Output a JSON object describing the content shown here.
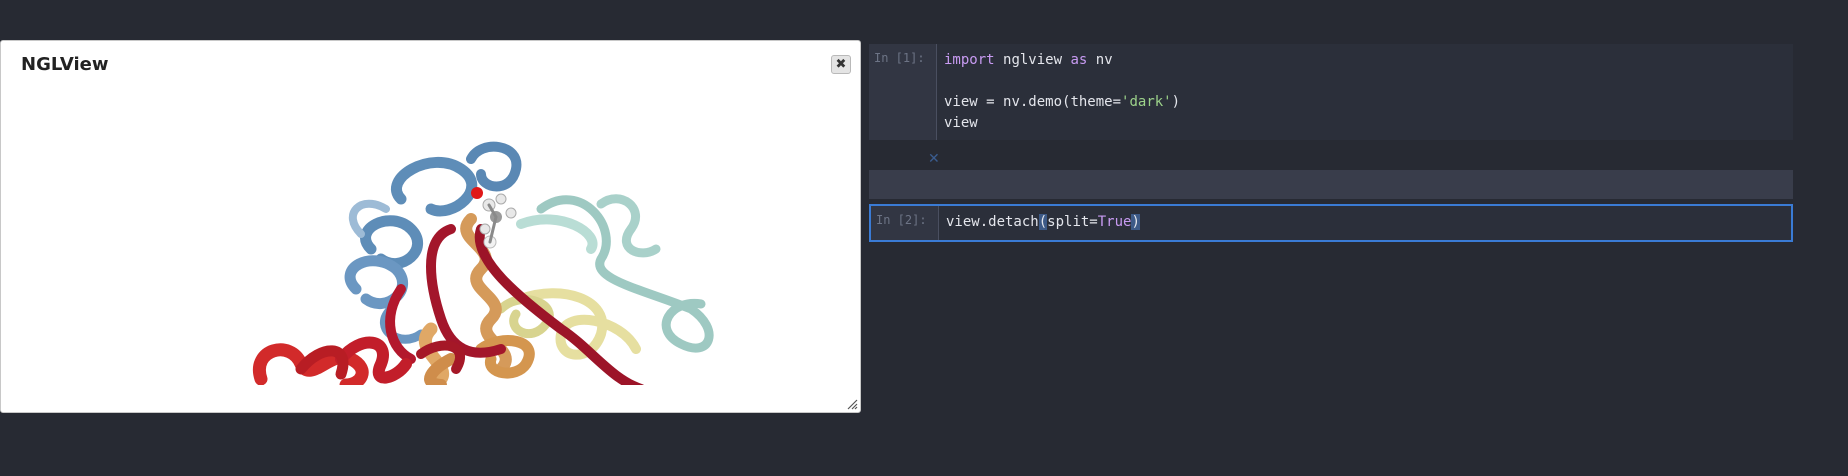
{
  "dialog": {
    "title": "NGLView",
    "close_icon": "close-icon"
  },
  "cells": [
    {
      "prompt": "In [1]:",
      "lines": [
        "import nglview as nv",
        "",
        "view = nv.demo(theme='dark')",
        "view"
      ]
    },
    {
      "prompt": "In [2]:",
      "code": "view.detach(split=True)"
    }
  ],
  "output_clear_icon": "x-icon",
  "colors": {
    "background": "#272a33",
    "cell_background": "#2b2f3a",
    "selected_border": "#3a7bd5",
    "keyword": "#c89bf2",
    "string": "#9cd28a"
  }
}
